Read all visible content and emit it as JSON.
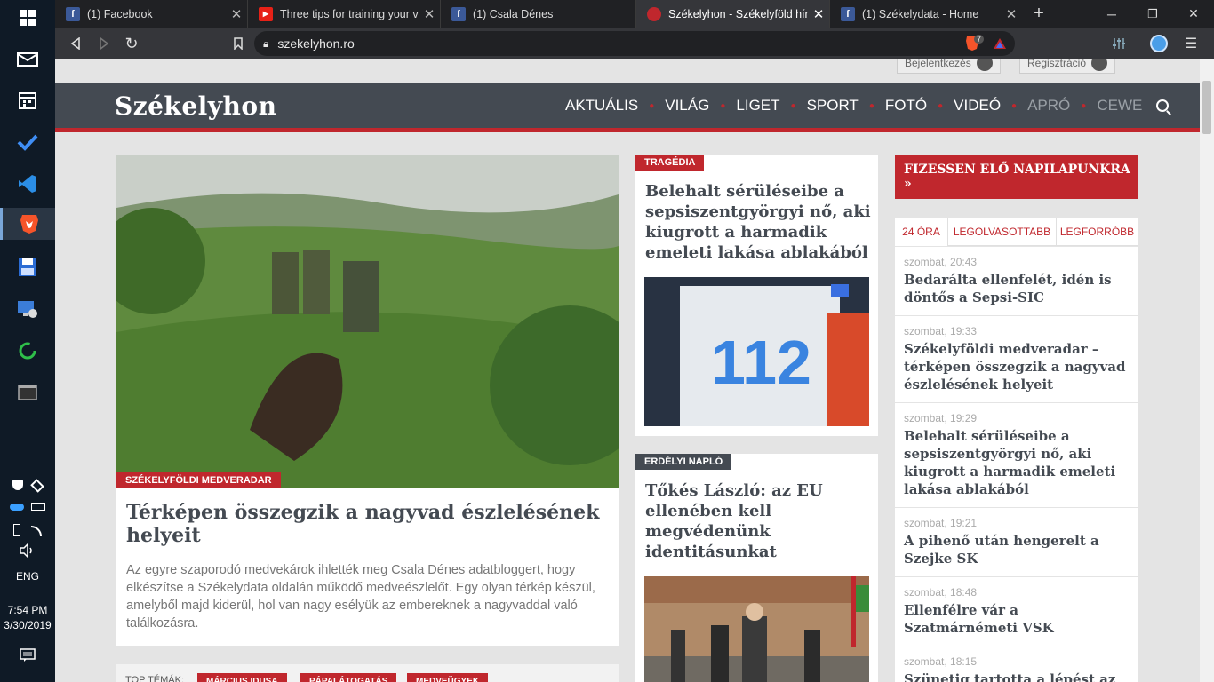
{
  "taskbar": {
    "tray": {
      "language": "ENG",
      "time": "7:54 PM",
      "date": "3/30/2019"
    }
  },
  "browser": {
    "tabs": [
      {
        "label": "(1) Facebook",
        "icon": "facebook-icon"
      },
      {
        "label": "Three tips for training your vo",
        "icon": "youtube-icon"
      },
      {
        "label": "(1) Csala Dénes",
        "icon": "facebook-icon"
      },
      {
        "label": "Székelyhon - Székelyföld hírp",
        "icon": "szekelyhon-icon"
      },
      {
        "label": "(1) Székelydata - Home",
        "icon": "facebook-icon"
      }
    ],
    "url": "szekelyhon.ro",
    "brave_badge": "7"
  },
  "site": {
    "logo": "Székelyhon",
    "login_label": "Bejelentkezés",
    "register_label": "Regisztráció",
    "nav": [
      "AKTUÁLIS",
      "VILÁG",
      "LIGET",
      "SPORT",
      "FOTÓ",
      "VIDEÓ",
      "APRÓ",
      "CEWE"
    ]
  },
  "main_article": {
    "tag": "SZÉKELYFÖLDI MEDVERADAR",
    "title": "Térképen összegzik a nagyvad észlelésének helyeit",
    "lead": "Az egyre szaporodó medvekárok ihlették meg Csala Dénes adatbloggert, hogy elkészítse a Székelydata oldalán működő medveészlelőt. Egy olyan térkép készül, amelyből majd kiderül, hol van nagy esélyük az embereknek a nagyvaddal való találkozásra."
  },
  "article2": {
    "tag": "TRAGÉDIA",
    "title": "Belehalt sérüléseibe a sepsiszentgyörgyi nő, aki kiugrott a harmadik emeleti lakása ablakából",
    "image_text": "112"
  },
  "article3": {
    "tag": "ERDÉLYI NAPLÓ",
    "title": "Tőkés László: az EU ellenében kell megvédenünk identitásunkat"
  },
  "topics": {
    "label": "TOP TÉMÁK:",
    "items": [
      "MÁRCIUS IDUSA",
      "PÁPALÁTOGATÁS",
      "MEDVEÜGYEK"
    ]
  },
  "subscribe": {
    "label": "FIZESSEN ELŐ NAPILAPUNKRA »"
  },
  "sidebar": {
    "tabs": [
      "24 ÓRA",
      "LEGOLVASOTTABB",
      "LEGFORRÓBB"
    ],
    "items": [
      {
        "time": "szombat, 20:43",
        "title": "Bedarálta ellenfelét, idén is döntős a Sepsi-SIC"
      },
      {
        "time": "szombat, 19:33",
        "title": "Székelyföldi medveradar – térképen összegzik a nagyvad észlelésének helyeit"
      },
      {
        "time": "szombat, 19:29",
        "title": "Belehalt sérüléseibe a sepsiszentgyörgyi nő, aki kiugrott a harmadik emeleti lakása ablakából"
      },
      {
        "time": "szombat, 19:21",
        "title": "A pihenő után hengerelt a Szejke SK"
      },
      {
        "time": "szombat, 18:48",
        "title": "Ellenfélre vár a Szatmárnémeti VSK"
      },
      {
        "time": "szombat, 18:15",
        "title": "Szünetig tartotta a lépést az MSE"
      }
    ]
  },
  "colors": {
    "brand_red": "#c0272d",
    "header_gray": "#444a52"
  }
}
